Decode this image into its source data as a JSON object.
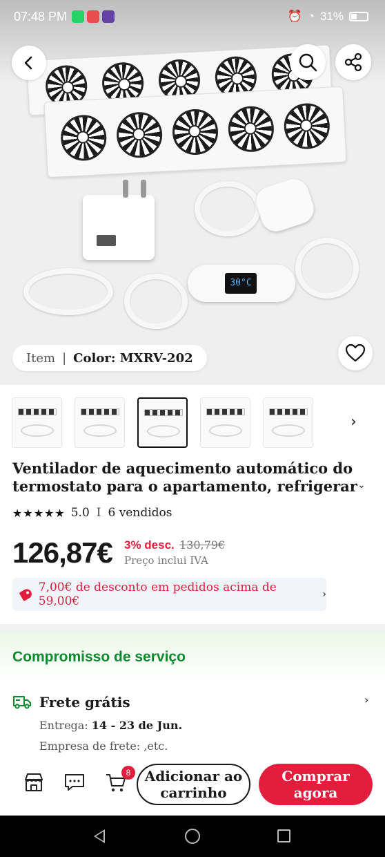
{
  "status_bar": {
    "time": "07:48 PM",
    "battery": "31%",
    "app_icon_colors": [
      "#25d366",
      "#e84c4c",
      "#6441a5"
    ]
  },
  "hero": {
    "item_label": "Item",
    "separator": "|",
    "color_label": "Color: MXRV-202",
    "thermostat_display": "30°C",
    "icons": {
      "back": "chevron-left-icon",
      "search": "search-icon",
      "share": "share-icon",
      "favorite": "heart-icon"
    }
  },
  "thumbnails": {
    "count": 5,
    "selected_index": 2,
    "next_icon": "chevron-right-icon"
  },
  "product": {
    "title": "Ventilador de aquecimento automático do termostato para o apartamento, refrigerar da l...",
    "stars": "★★★★★",
    "rating": "5.0",
    "rating_separator": "I",
    "sold": "6 vendidos",
    "price": "126,87€",
    "discount": "3% desc.",
    "original_price": "130,79€",
    "vat_note": "Preço inclui IVA",
    "coupon": "7,00€ de desconto em pedidos acima de 59,00€"
  },
  "service": {
    "heading": "Compromisso de serviço",
    "shipping_title": "Frete grátis",
    "delivery_label": "Entrega:",
    "delivery_dates": "14 - 23 de Jun.",
    "carrier_line": "Empresa de frete: ,etc."
  },
  "action_bar": {
    "cart_badge": "8",
    "add_to_cart": "Adicionar ao carrinho",
    "buy_now": "Comprar agora",
    "icons": [
      "store-icon",
      "chat-icon",
      "cart-icon"
    ]
  },
  "colors": {
    "accent_red": "#e31e3c",
    "service_green": "#0a8a2c"
  }
}
